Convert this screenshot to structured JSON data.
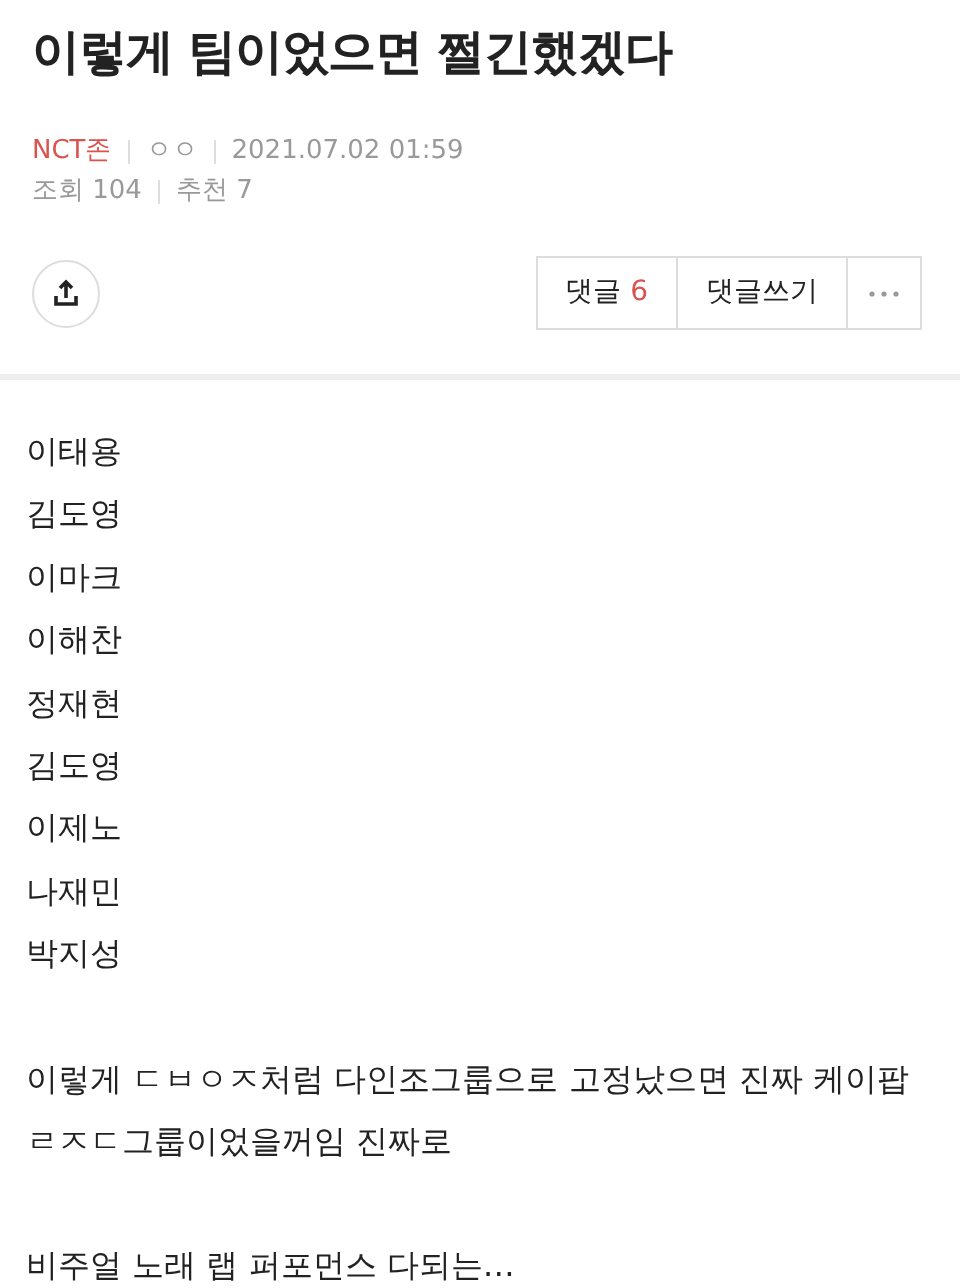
{
  "title": "이렇게 팀이었으면 쩔긴했겠다",
  "meta": {
    "board": "NCT존",
    "author": "ㅇㅇ",
    "date": "2021.07.02 01:59",
    "views": "조회 104",
    "recommend": "추천 7"
  },
  "actions": {
    "comments_label": "댓글",
    "comments_count": "6",
    "write": "댓글쓰기"
  },
  "body": {
    "names": [
      "이태용",
      "김도영",
      "이마크",
      "이해찬",
      "정재현",
      "김도영",
      "이제노",
      "나재민",
      "박지성"
    ],
    "paragraphs": [
      "이렇게 ㄷㅂㅇㅈ처럼 다인조그룹으로 고정났으면 진짜 케이팝 ㄹㅈㄷ그룹이었을꺼임 진짜로",
      "비주얼 노래 랩 퍼포먼스 다되는…"
    ]
  }
}
